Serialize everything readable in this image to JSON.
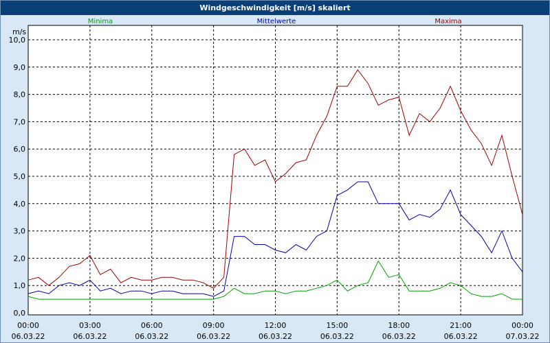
{
  "chart_data": {
    "type": "line",
    "title": "Windgeschwindigkeit [m/s] skaliert",
    "ylabel": "m/s",
    "ylim": [
      0,
      11
    ],
    "yticks": [
      "0,0",
      "1,0",
      "2,0",
      "3,0",
      "4,0",
      "5,0",
      "6,0",
      "7,0",
      "8,0",
      "9,0",
      "10,0"
    ],
    "xlim": [
      0,
      24
    ],
    "xticks": [
      {
        "time": "00:00",
        "date": "06.03.22"
      },
      {
        "time": "03:00",
        "date": "06.03.22"
      },
      {
        "time": "06:00",
        "date": "06.03.22"
      },
      {
        "time": "09:00",
        "date": "06.03.22"
      },
      {
        "time": "12:00",
        "date": "06.03.22"
      },
      {
        "time": "15:00",
        "date": "06.03.22"
      },
      {
        "time": "18:00",
        "date": "06.03.22"
      },
      {
        "time": "21:00",
        "date": "06.03.22"
      },
      {
        "time": "00:00",
        "date": "07.03.22"
      }
    ],
    "grid": true,
    "legend_placement": "top",
    "x_hours": [
      0,
      0.5,
      1,
      1.5,
      2,
      2.5,
      3,
      3.5,
      4,
      4.5,
      5,
      5.5,
      6,
      6.5,
      7,
      7.5,
      8,
      8.5,
      9,
      9.5,
      10,
      10.5,
      11,
      11.5,
      12,
      12.5,
      13,
      13.5,
      14,
      14.5,
      15,
      15.5,
      16,
      16.5,
      17,
      17.5,
      18,
      18.5,
      19,
      19.5,
      20,
      20.5,
      21,
      21.5,
      22,
      22.5,
      23,
      23.5,
      24
    ],
    "series": [
      {
        "name": "Minima",
        "color": "#00a000",
        "values": [
          0.6,
          0.5,
          0.5,
          0.5,
          0.5,
          0.5,
          0.5,
          0.5,
          0.5,
          0.5,
          0.5,
          0.5,
          0.5,
          0.5,
          0.5,
          0.5,
          0.5,
          0.5,
          0.5,
          0.6,
          0.9,
          0.7,
          0.7,
          0.8,
          0.8,
          0.7,
          0.8,
          0.8,
          0.9,
          1.0,
          1.2,
          0.8,
          1.0,
          1.1,
          1.9,
          1.3,
          1.4,
          0.8,
          0.8,
          0.8,
          0.9,
          1.1,
          1.0,
          0.7,
          0.6,
          0.6,
          0.7,
          0.5,
          0.5
        ]
      },
      {
        "name": "Mittelwerte",
        "color": "#0000b0",
        "values": [
          0.7,
          0.8,
          0.7,
          1.0,
          1.1,
          1.0,
          1.2,
          0.8,
          0.9,
          0.7,
          0.8,
          0.8,
          0.7,
          0.8,
          0.8,
          0.7,
          0.7,
          0.7,
          0.6,
          0.8,
          2.8,
          2.8,
          2.5,
          2.5,
          2.3,
          2.2,
          2.5,
          2.3,
          2.8,
          3.0,
          4.3,
          4.5,
          4.8,
          4.8,
          4.0,
          4.0,
          4.0,
          3.4,
          3.6,
          3.5,
          3.8,
          4.5,
          3.6,
          3.2,
          2.8,
          2.2,
          3.0,
          2.0,
          1.5
        ]
      },
      {
        "name": "Maxima",
        "color": "#a00000",
        "values": [
          1.2,
          1.3,
          1.0,
          1.3,
          1.7,
          1.8,
          2.1,
          1.4,
          1.6,
          1.1,
          1.3,
          1.2,
          1.2,
          1.3,
          1.3,
          1.2,
          1.2,
          1.1,
          0.9,
          1.3,
          5.8,
          6.0,
          5.4,
          5.6,
          4.8,
          5.1,
          5.5,
          5.6,
          6.5,
          7.2,
          8.3,
          8.3,
          8.9,
          8.4,
          7.6,
          7.8,
          7.9,
          6.5,
          7.3,
          7.0,
          7.5,
          8.3,
          7.4,
          6.7,
          6.2,
          5.4,
          6.5,
          5.0,
          3.6
        ]
      }
    ]
  }
}
